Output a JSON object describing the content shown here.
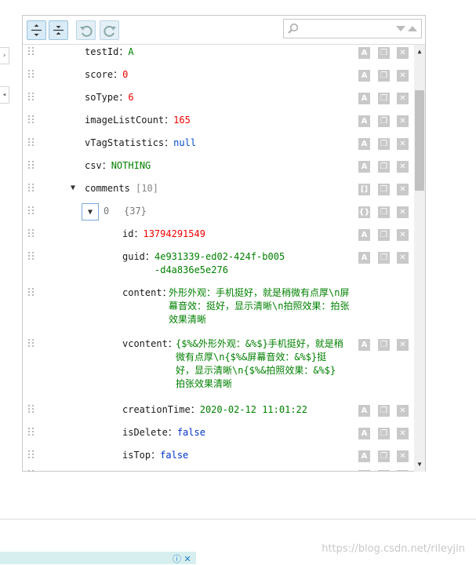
{
  "toolbar": {
    "buttons": [
      "expand-all",
      "collapse-all",
      "undo",
      "redo"
    ],
    "search_placeholder": ""
  },
  "rows": [
    {
      "key": "testId",
      "value": "A",
      "type": "str"
    },
    {
      "key": "score",
      "value": "0",
      "type": "num"
    },
    {
      "key": "soType",
      "value": "6",
      "type": "num"
    },
    {
      "key": "imageListCount",
      "value": "165",
      "type": "num"
    },
    {
      "key": "vTagStatistics",
      "value": "null",
      "type": "nul"
    },
    {
      "key": "csv",
      "value": "NOTHING",
      "type": "str"
    },
    {
      "key": "comments",
      "count": "[10]",
      "type": "array"
    },
    {
      "index": "0",
      "count": "{37}",
      "type": "object"
    },
    {
      "key": "id",
      "value": "13794291549",
      "type": "num"
    },
    {
      "key": "guid",
      "value": "4e931339-ed02-424f-b005-d4a836e5e276",
      "type": "str"
    },
    {
      "key": "content",
      "value": "外形外观：手机挺好，就是稍微有点厚\\n屏幕音效：挺好，显示清晰\\n拍照效果：拍张效果清晰",
      "type": "str"
    },
    {
      "key": "vcontent",
      "value": "{$%&外形外观：&%$}手机挺好，就是稍微有点厚\\n{$%&屏幕音效：&%$}挺好，显示清晰\\n{$%&拍照效果：&%$}拍张效果清晰",
      "type": "str"
    },
    {
      "key": "creationTime",
      "value": "2020-02-12 11:01:22",
      "type": "str"
    },
    {
      "key": "isDelete",
      "value": "false",
      "type": "bool"
    },
    {
      "key": "isTop",
      "value": "false",
      "type": "bool"
    }
  ],
  "colors": {
    "number": "#ee0000",
    "string": "#008000",
    "null": "#004ed0",
    "boolean": "#0033cc"
  },
  "watermark": "https://blog.csdn.net/rileyjin"
}
